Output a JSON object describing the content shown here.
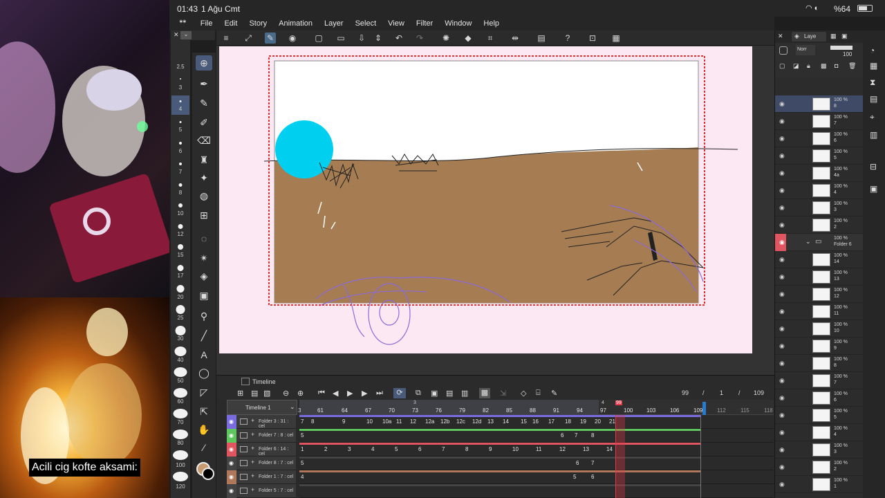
{
  "status_bar": {
    "time": "01:43",
    "date": "1 Ağu Cmt",
    "battery": "%64"
  },
  "overlay_caption": "Acili cig kofte aksami:",
  "menu": [
    "File",
    "Edit",
    "Story",
    "Animation",
    "Layer",
    "Select",
    "View",
    "Filter",
    "Window",
    "Help"
  ],
  "brush_sizes": [
    "2.5",
    "3",
    "4",
    "5",
    "6",
    "7",
    "8",
    "10",
    "12",
    "15",
    "17",
    "20",
    "25",
    "30",
    "40",
    "50",
    "60",
    "70",
    "80",
    "100",
    "120"
  ],
  "timeline": {
    "panel_title": "Timeline",
    "name": "Timeline 1",
    "current_frame": "99",
    "sep1": "/",
    "start": "1",
    "sep2": "/",
    "end": "109",
    "ruler": [
      "61",
      "64",
      "67",
      "70",
      "73",
      "76",
      "79",
      "82",
      "85",
      "88",
      "91",
      "94",
      "97",
      "100",
      "103",
      "106",
      "109",
      "112",
      "115",
      "118"
    ],
    "ruler_marks": {
      "a": "3",
      "b": "4",
      "c": "99"
    },
    "tracks": [
      {
        "name": "Folder 3 : 31 : cel",
        "color": "#7b6be0",
        "cells": [
          "7",
          "8",
          "9",
          "10",
          "10a",
          "11",
          "12",
          "12a",
          "12b",
          "12c",
          "12d",
          "13",
          "14",
          "15",
          "16",
          "17",
          "18",
          "19",
          "20",
          "21"
        ]
      },
      {
        "name": "Folder 7 : 8 : cel",
        "color": "#5fc65f",
        "cells": [
          "5",
          "6",
          "7",
          "8"
        ]
      },
      {
        "name": "Folder 6 : 14 : cel",
        "color": "#e0555f",
        "cells": [
          "1",
          "2",
          "3",
          "4",
          "5",
          "6",
          "7",
          "8",
          "9",
          "10",
          "11",
          "12",
          "13",
          "14"
        ]
      },
      {
        "name": "Folder 8 : 7 : cel",
        "color": "#444444",
        "cells": [
          "5",
          "6",
          "7"
        ]
      },
      {
        "name": "Folder 1 : 7 : cel",
        "color": "#b0785a",
        "cells": [
          "4",
          "5",
          "6"
        ]
      },
      {
        "name": "Folder 5 : 7 : cel",
        "color": "#444444",
        "cells": []
      }
    ]
  },
  "layers_panel": {
    "tab": "Laye",
    "blend": "Norr",
    "opacity": "100",
    "layers": [
      {
        "pct": "100 %",
        "name": "8",
        "selected": true
      },
      {
        "pct": "100 %",
        "name": "7"
      },
      {
        "pct": "100 %",
        "name": "6"
      },
      {
        "pct": "100 %",
        "name": "5"
      },
      {
        "pct": "100 %",
        "name": "4a"
      },
      {
        "pct": "100 %",
        "name": "4"
      },
      {
        "pct": "100 %",
        "name": "3"
      },
      {
        "pct": "100 %",
        "name": "2"
      },
      {
        "pct": "100 %",
        "name": "Folder 6",
        "folder": true
      },
      {
        "pct": "100 %",
        "name": "14"
      },
      {
        "pct": "100 %",
        "name": "13"
      },
      {
        "pct": "100 %",
        "name": "12"
      },
      {
        "pct": "100 %",
        "name": "11"
      },
      {
        "pct": "100 %",
        "name": "10"
      },
      {
        "pct": "100 %",
        "name": "9"
      },
      {
        "pct": "100 %",
        "name": "8"
      },
      {
        "pct": "100 %",
        "name": "7"
      },
      {
        "pct": "100 %",
        "name": "6"
      },
      {
        "pct": "100 %",
        "name": "5"
      },
      {
        "pct": "100 %",
        "name": "4"
      },
      {
        "pct": "100 %",
        "name": "3"
      },
      {
        "pct": "100 %",
        "name": "2"
      },
      {
        "pct": "100 %",
        "name": "1"
      }
    ]
  },
  "colors": {
    "sky": "#ffffff",
    "ground": "#a67c52",
    "sun": "#00cff0",
    "frame": "#e03030",
    "sketch": "#8a6ad8",
    "playhead": "#e03a4a"
  }
}
